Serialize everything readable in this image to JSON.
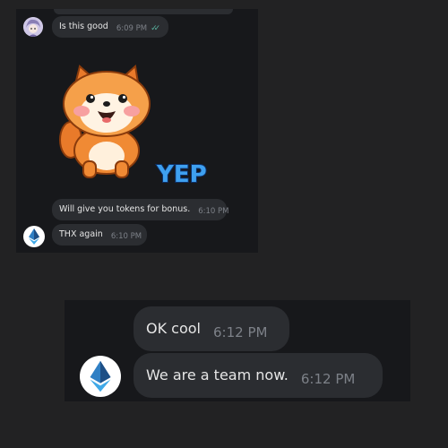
{
  "top_chat": {
    "messages": [
      {
        "text": "Is this good",
        "time": "6:09 PM"
      },
      {
        "text": "Will give you tokens for bonus.",
        "time": "6:10 PM"
      },
      {
        "text": "THX again",
        "time": "6:10 PM"
      }
    ],
    "sticker_text": "YEP"
  },
  "bottom_chat": {
    "messages": [
      {
        "text": "OK cool",
        "time": "6:12 PM"
      },
      {
        "text": "We are a team now.",
        "time": "6:12 PM"
      }
    ]
  }
}
